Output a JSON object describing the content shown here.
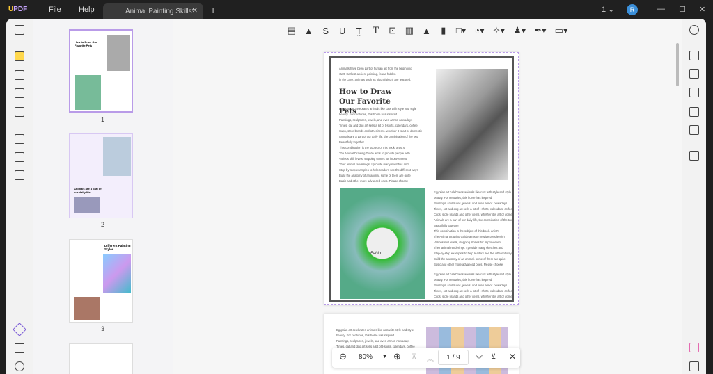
{
  "app": {
    "logo": "UPDF",
    "menu": [
      "File",
      "Help"
    ],
    "tab_title": "Animal Painting Skills*",
    "page_indicator": "1",
    "avatar_initial": "R"
  },
  "toolbar": {
    "tools": [
      "comment",
      "highlight",
      "strikethrough",
      "underline",
      "squiggly",
      "text",
      "textbox",
      "text-callout",
      "pencil",
      "eraser",
      "shape",
      "area",
      "pin",
      "stamp",
      "signature",
      "measure"
    ]
  },
  "thumbnails": [
    {
      "page": "1",
      "title": "How to Draw Our Favorite Pets"
    },
    {
      "page": "2",
      "title": "Animals are a part of our daily life"
    },
    {
      "page": "3",
      "title": "Different Painting Styles"
    }
  ],
  "page1": {
    "intro": [
      "Animals have been part of human art from the beginning",
      "start. Earliest ancient painting, found hidden",
      "in the cave, animals such as bison (Bison) are featured."
    ],
    "heading": "How to Draw Our Favorite Pets",
    "body": [
      "Egyptian art celebrates animals like cats with style and style",
      "beauty. For centuries, this horse has inspired",
      "Paintings, sculptures, jewels, and even armor. nowadays",
      "Times, cat and dog art sells a lot of t-shirts, calendars, coffee",
      "Cups, store brands and other items. whether it is art or domestic",
      "Animals are a part of our daily life, the combination of the two",
      "Beautifully together",
      "This combination is the subject of this book. artist's",
      "The Animal Drawing Guide aims to provide people with",
      "Various skill levels, stepping stones for improvement",
      "Their animal renderings. I provide many sketches and",
      "Step-by-step examples to help readers see the different ways",
      "Build the anatomy of an animal. some of them are quite",
      "Basic and other more advanced ones. Please choose"
    ],
    "photo_caption": "Fabio"
  },
  "zoom": {
    "level": "80%",
    "current_page": "1",
    "total_pages": "9",
    "page_display": "1 / 9"
  }
}
